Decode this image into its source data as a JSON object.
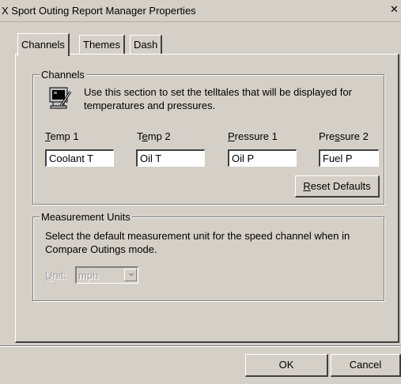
{
  "window": {
    "title": "X Sport Outing Report Manager Properties",
    "close_glyph": "✕"
  },
  "tabs": [
    {
      "label": "Channels",
      "active": true
    },
    {
      "label": "Themes",
      "active": false
    },
    {
      "label": "Dash",
      "active": false
    }
  ],
  "channels": {
    "legend": "Channels",
    "description": "Use this section to set the telltales that will be displayed for temperatures and pressures.",
    "fields": [
      {
        "label_mnemonic": "T",
        "label_rest": "emp 1",
        "value": "Coolant T"
      },
      {
        "label_pre": "T",
        "label_mnemonic": "e",
        "label_rest": "mp 2",
        "value": "Oil T"
      },
      {
        "label_mnemonic": "P",
        "label_rest": "ressure 1",
        "value": "Oil P"
      },
      {
        "label_pre": "Pre",
        "label_mnemonic": "s",
        "label_rest": "sure 2",
        "value": "Fuel P"
      }
    ],
    "reset_mnemonic": "R",
    "reset_rest": "eset Defaults"
  },
  "measurement": {
    "legend": "Measurement Units",
    "description": "Select the default measurement unit for the speed channel when in Compare Outings mode.",
    "unit_mnemonic": "U",
    "unit_rest": "nit:",
    "unit_value": "mph"
  },
  "footer": {
    "ok_label": "OK",
    "cancel_label": "Cancel"
  },
  "colors": {
    "dialog_bg": "#d4d0c8",
    "highlight": "#ffffff",
    "shadow": "#404040"
  },
  "icons": {
    "channels_icon": "monitor-with-pen-icon"
  }
}
